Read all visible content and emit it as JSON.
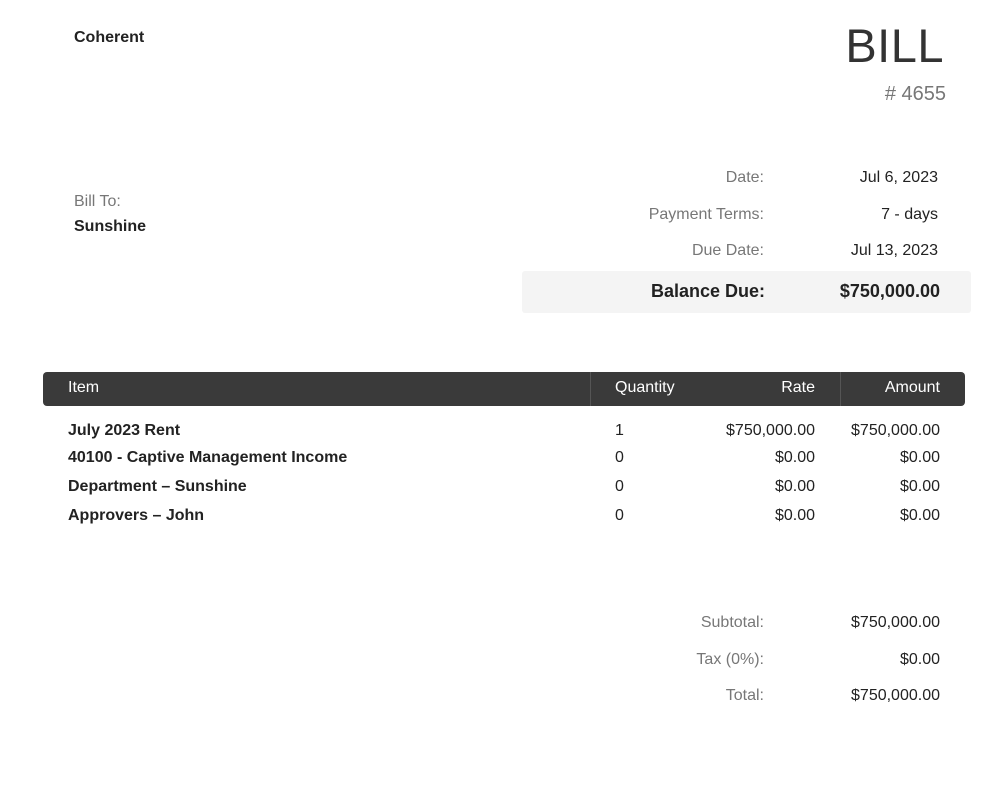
{
  "header": {
    "company": "Coherent",
    "title": "BILL",
    "number": "# 4655"
  },
  "bill_to": {
    "label": "Bill To:",
    "name": "Sunshine"
  },
  "meta": {
    "date_label": "Date:",
    "date_value": "Jul 6, 2023",
    "terms_label": "Payment Terms:",
    "terms_value": "7 - days",
    "due_label": "Due Date:",
    "due_value": "Jul 13, 2023",
    "balance_label": "Balance Due:",
    "balance_value": "$750,000.00"
  },
  "table": {
    "headers": {
      "item": "Item",
      "quantity": "Quantity",
      "rate": "Rate",
      "amount": "Amount"
    },
    "rows": [
      {
        "item": "July 2023 Rent",
        "quantity": "1",
        "rate": "$750,000.00",
        "amount": "$750,000.00"
      },
      {
        "item": "40100 - Captive Management Income",
        "quantity": "0",
        "rate": "$0.00",
        "amount": "$0.00"
      },
      {
        "item": "Department – Sunshine",
        "quantity": "0",
        "rate": "$0.00",
        "amount": "$0.00"
      },
      {
        "item": "Approvers – John",
        "quantity": "0",
        "rate": "$0.00",
        "amount": "$0.00"
      }
    ]
  },
  "totals": {
    "subtotal_label": "Subtotal:",
    "subtotal_value": "$750,000.00",
    "tax_label": "Tax (0%):",
    "tax_value": "$0.00",
    "total_label": "Total:",
    "total_value": "$750,000.00"
  },
  "colors": {
    "table_header_bg": "#3a3a3a",
    "balance_bg": "#f4f4f4",
    "muted_text": "#777777"
  }
}
